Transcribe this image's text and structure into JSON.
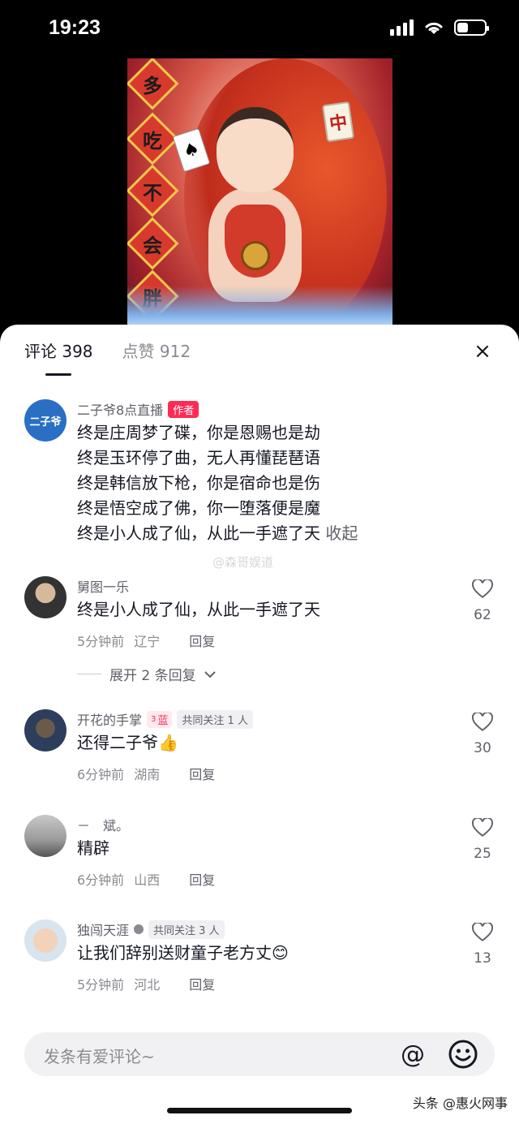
{
  "status": {
    "time": "19:23"
  },
  "poster": {
    "banner_chars": [
      "多",
      "吃",
      "不",
      "会",
      "胖"
    ],
    "mahjong_tile": "中",
    "card": "♠"
  },
  "sheet": {
    "tabs": [
      {
        "label": "评论 398"
      },
      {
        "label": "点赞 912"
      }
    ],
    "close_label": "×"
  },
  "watermark": "@森哥娱道",
  "comments": [
    {
      "name": "二子爷8点直播",
      "tag": "作者",
      "avatar_text": "二子爷",
      "lines": [
        "终是庄周梦了碟，你是恩赐也是劫",
        "终是玉环停了曲，无人再懂琵琶语",
        "终是韩信放下枪，你是宿命也是伤",
        "终是悟空成了佛，你一堕落便是魔",
        "终是小人成了仙，从此一手遮了天"
      ],
      "collapse_label": "收起"
    },
    {
      "name": "舅图一乐",
      "text": "终是小人成了仙，从此一手遮了天",
      "time": "5分钟前",
      "region": "辽宁",
      "reply_label": "回复",
      "likes": "62",
      "expand_label": "展开 2 条回复"
    },
    {
      "name": "开花的手掌",
      "badge_level": "3",
      "badge_label": "蓝",
      "mutual": "共同关注 1 人",
      "text": "还得二子爷👍",
      "time": "6分钟前",
      "region": "湖南",
      "reply_label": "回复",
      "likes": "30"
    },
    {
      "name": "－　斌。",
      "text": "精辟",
      "time": "6分钟前",
      "region": "山西",
      "reply_label": "回复",
      "likes": "25"
    },
    {
      "name": "独闯天涯",
      "mutual": "共同关注 3 人",
      "text": "让我们辞别送财童子老方丈😊",
      "time": "5分钟前",
      "region": "河北",
      "reply_label": "回复",
      "likes": "13"
    }
  ],
  "input": {
    "placeholder": "发条有爱评论~"
  },
  "source_tag": "头条 @惠火网事",
  "colors": {
    "accent": "#fe2c55",
    "text_primary": "#161823",
    "text_secondary": "#8a8b91"
  }
}
